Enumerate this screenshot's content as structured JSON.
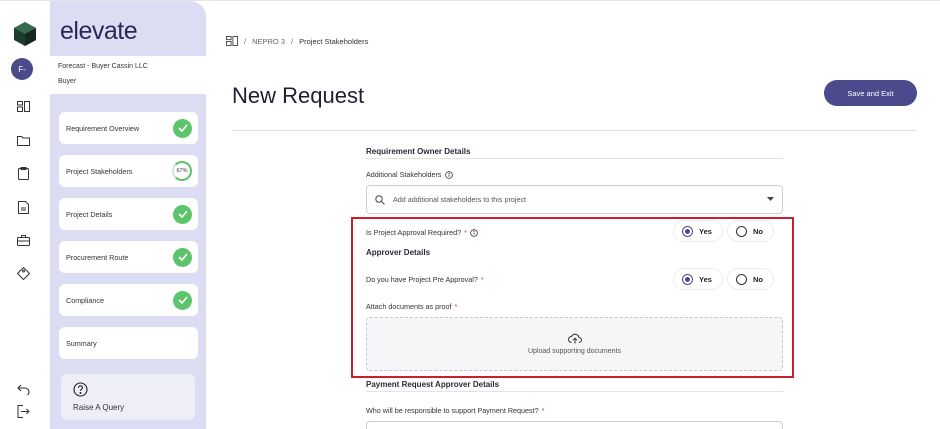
{
  "brand": {
    "name": "elevate",
    "avatar_initials": "F-"
  },
  "org": {
    "name": "Forecast - Buyer Cassin LLC",
    "role": "Buyer"
  },
  "steps": [
    {
      "label": "Requirement Overview",
      "status": "complete"
    },
    {
      "label": "Project Stakeholders",
      "status": "in-progress",
      "progress": "67%"
    },
    {
      "label": "Project Details",
      "status": "complete"
    },
    {
      "label": "Procurement Route",
      "status": "complete"
    },
    {
      "label": "Compliance",
      "status": "complete"
    },
    {
      "label": "Summary",
      "status": "pending"
    }
  ],
  "query": {
    "label": "Raise A Query"
  },
  "breadcrumb": {
    "project": "NEPRO 3",
    "current": "Project Stakeholders"
  },
  "page": {
    "title": "New Request",
    "save_label": "Save and Exit"
  },
  "form": {
    "owner_section": "Requirement Owner Details",
    "stakeholders_label": "Additional Stakeholders",
    "stakeholders_placeholder": "Add additional stakeholders to this project",
    "approval_required_label": "Is Project Approval Required?",
    "approval_required_value": "Yes",
    "approver_section": "Approver Details",
    "pre_approval_label": "Do you have Project Pre Approval?",
    "pre_approval_value": "Yes",
    "yes": "Yes",
    "no": "No",
    "attach_label": "Attach documents as proof",
    "upload_label": "Upload supporting documents",
    "payment_section": "Payment Request Approver Details",
    "payment_responsible_label": "Who will be responsible to support Payment Request?",
    "required_mark": "*"
  },
  "colors": {
    "accent": "#4a4a8c",
    "success": "#5cc56b",
    "sidebar": "#dcdcf2",
    "highlight": "#c7202d"
  }
}
